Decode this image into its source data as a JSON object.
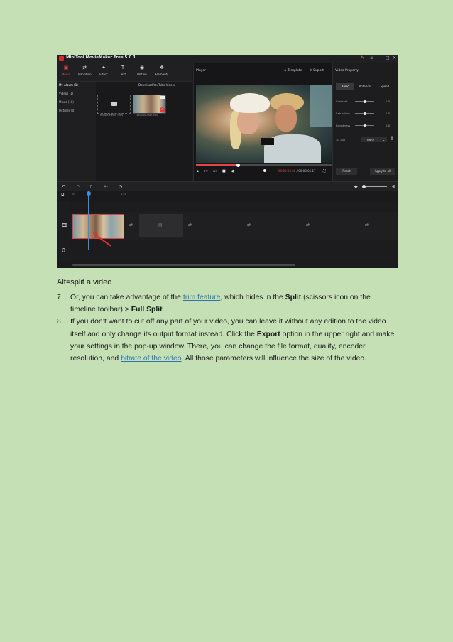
{
  "app": {
    "title": "MiniTool MovieMaker Free 5.0.1",
    "toolbar": [
      {
        "label": "Media",
        "icon": "media-icon",
        "glyph": "▣"
      },
      {
        "label": "Transition",
        "icon": "transition-icon",
        "glyph": "⇄"
      },
      {
        "label": "Effect",
        "icon": "effect-icon",
        "glyph": "✦"
      },
      {
        "label": "Text",
        "icon": "text-icon",
        "glyph": "T"
      },
      {
        "label": "Motion",
        "icon": "motion-icon",
        "glyph": "◉"
      },
      {
        "label": "Elements",
        "icon": "elements-icon",
        "glyph": "❖"
      }
    ],
    "library": {
      "sidebar": [
        "My Album (1)",
        "Videos (1)",
        "Music (10)",
        "Pictures (0)"
      ],
      "download_link": "Download YouTube Videos",
      "import_caption": "Import Media Files",
      "thumb_caption": "1804000 Sol.mp4"
    },
    "player": {
      "title": "Player",
      "template_label": "Template",
      "export_label": "Export",
      "progress": 0.31,
      "time_current": "00:00:03.00",
      "time_total": "/ 00:00:05.17"
    },
    "properties": {
      "title": "Video Property",
      "tabs": [
        "Basic",
        "Rotation",
        "Speed"
      ],
      "rows": [
        {
          "label": "Contrast",
          "value": "0.0",
          "level": 0.5
        },
        {
          "label": "Saturation",
          "value": "0.0",
          "level": 0.5
        },
        {
          "label": "Brightness",
          "value": "0.0",
          "level": 0.5
        }
      ],
      "lut_label": "3D LUT",
      "lut_value": "None",
      "reset_label": "Reset",
      "apply_label": "Apply to all"
    },
    "timeline": {
      "ruler": [
        "0s",
        "1.5s"
      ]
    },
    "colors": {
      "accent": "#e04646",
      "playhead": "#3c8ce0"
    }
  },
  "document": {
    "caption": "Alt=split a video",
    "items": [
      {
        "num": "7.",
        "t1": "Or, you can take advantage of the ",
        "link": "trim feature",
        "t2": ", which hides in the ",
        "b1": "Split",
        "t3": " (scissors icon on the timeline toolbar) > ",
        "b2": "Full Split",
        "t4": "."
      },
      {
        "num": "8.",
        "t1": "If you don’t want to cut off any part of your video, you can leave it without any edition to the video itself and only change its output format instead. Click the ",
        "b1": "Export",
        "t2": " option in the upper right and make your settings in the pop-up window. There, you can change the file format, quality, encoder, resolution, and ",
        "link": "bitrate of the video",
        "t3": ". All those parameters will influence the size of the video."
      }
    ]
  }
}
